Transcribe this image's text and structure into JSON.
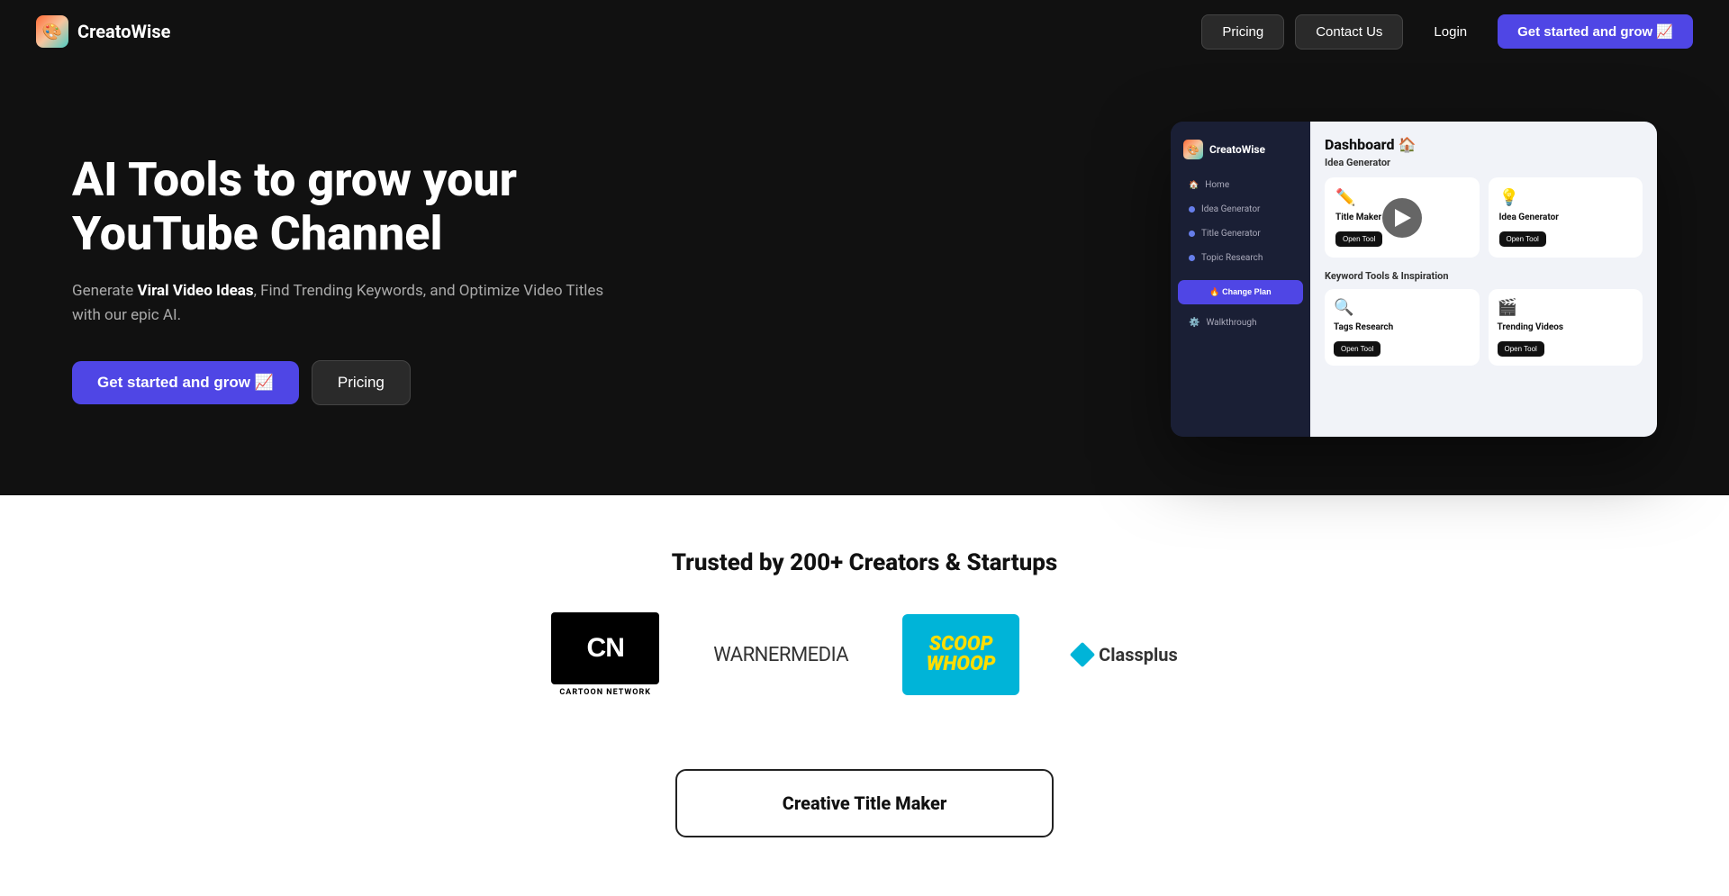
{
  "brand": {
    "name": "CreatoWise",
    "logo_emoji": "🎨"
  },
  "nav": {
    "pricing_label": "Pricing",
    "contact_label": "Contact Us",
    "login_label": "Login",
    "cta_label": "Get started and grow 📈"
  },
  "hero": {
    "title_line1": "AI Tools to grow your",
    "title_line2": "YouTube Channel",
    "subtitle_start": "Generate ",
    "subtitle_bold": "Viral Video Ideas",
    "subtitle_end": ", Find Trending Keywords, and Optimize Video Titles with our epic AI.",
    "cta_label": "Get started and grow 📈",
    "pricing_label": "Pricing"
  },
  "dashboard": {
    "logo": "CreatoWise",
    "title": "Dashboard 🏠",
    "section1": "Idea Generator",
    "card1_icon": "✏️",
    "card1_title": "Title Maker",
    "card1_btn": "Open Tool",
    "card2_icon": "💡",
    "card2_title": "Idea Generator",
    "card2_btn": "Open Tool",
    "section2": "Keyword Tools & Inspiration",
    "card3_icon": "🔍",
    "card3_title": "Tags Research",
    "card3_btn": "Open Tool",
    "card4_icon": "🎬",
    "card4_title": "Trending Videos",
    "card4_btn": "Open Tool",
    "nav_home": "Home",
    "nav_idea": "Idea Generator",
    "nav_title": "Title Generator",
    "nav_topic": "Topic Research",
    "change_plan": "🔥 Change Plan",
    "walkthrough": "Walkthrough"
  },
  "trusted": {
    "title": "Trusted by 200+ Creators & Startups",
    "logo1_line1": "CN",
    "logo1_line2": "CARTOON NETWORK",
    "logo2": "WARNERMEDIA",
    "logo3_line1": "SCOOP",
    "logo3_line2": "WHOOP",
    "logo4": "Classplus"
  },
  "bottom": {
    "creative_title": "Creative Title Maker"
  }
}
